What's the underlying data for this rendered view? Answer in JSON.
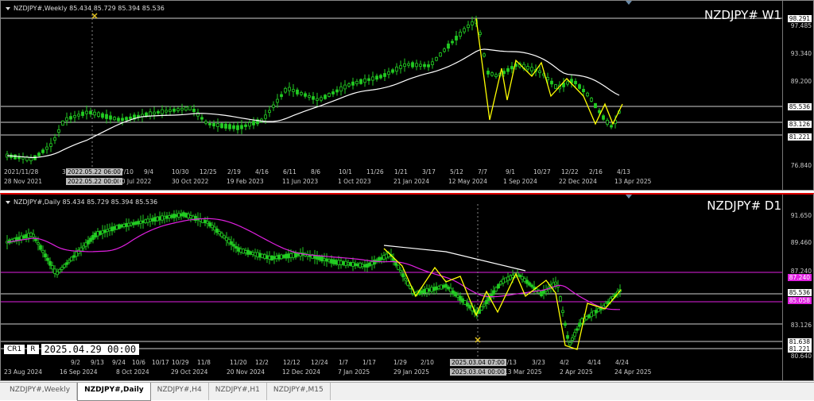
{
  "weekly": {
    "header": "NZDJPY#,Weekly  85.434 85.729 85.394 85.536",
    "big_label": "NZDJPY#  W1",
    "price_labels": [
      "98.291",
      "97.485",
      "93.340",
      "89.200",
      "85.536",
      "83.126",
      "81.221",
      "76.840"
    ],
    "time_labels_top": [
      "2021/11/28",
      "3",
      "2022.05.22 06:00",
      "7/10",
      "9/4",
      "10/30",
      "12/25",
      "2/19",
      "4/16",
      "6/11",
      "8/6",
      "10/1",
      "11/26",
      "1/21",
      "3/17",
      "5/12",
      "7/7",
      "9/1",
      "10/27",
      "12/22",
      "2/16",
      "4/13"
    ],
    "time_labels_bottom": [
      "28 Nov 2021",
      "2022.05.22 00:00",
      "10 Jul 2022",
      "30 Oct 2022",
      "19 Feb 2023",
      "11 Jun 2023",
      "1 Oct 2023",
      "21 Jan 2024",
      "12 May 2024",
      "1 Sep 2024",
      "22 Dec 2024",
      "13 Apr 2025"
    ]
  },
  "daily": {
    "header": "NZDJPY#,Daily  85.434 85.729 85.394 85.536",
    "big_label": "NZDJPY#  D1",
    "price_labels": [
      "91.650",
      "89.460",
      "87.240",
      "85.536",
      "85.058",
      "83.126",
      "81.638",
      "81.221",
      "80.640"
    ],
    "time_labels_top": [
      "9/2",
      "9/13",
      "9/24",
      "10/6",
      "10/17",
      "10/29",
      "11/8",
      "11/20",
      "12/2",
      "12/12",
      "12/24",
      "1/7",
      "1/17",
      "1/29",
      "2/10",
      "2025.03.04 07:00",
      "3/13",
      "3/23",
      "4/2",
      "4/14",
      "4/24"
    ],
    "time_labels_bottom": [
      "23 Aug 2024",
      "16 Sep 2024",
      "8 Oct 2024",
      "29 Oct 2024",
      "20 Nov 2024",
      "12 Dec 2024",
      "7 Jan 2025",
      "29 Jan 2025",
      "2025.03.04 00:00",
      "13 Mar 2025",
      "2 Apr 2025",
      "24 Apr 2025"
    ],
    "mode_buttons": [
      "CR1",
      "R"
    ],
    "crosshair_time": "2025.04.29 00:00"
  },
  "tabs": [
    "NZDJPY#,Weekly",
    "NZDJPY#,Daily",
    "NZDJPY#,H4",
    "NZDJPY#,H1",
    "NZDJPY#,M15"
  ],
  "active_tab": 1,
  "colors": {
    "candle": "#22cc22",
    "ma_weekly": "#ffffff",
    "ma_daily": "#e020e0",
    "zigzag": "#ffff00",
    "bg": "#000000"
  }
}
